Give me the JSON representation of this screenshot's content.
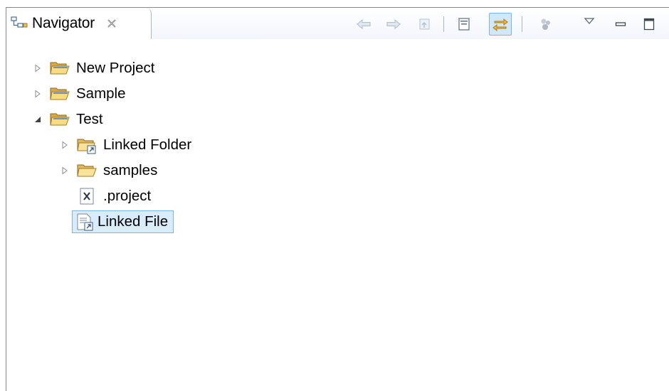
{
  "view": {
    "title": "Navigator",
    "icon": "navigator-icon",
    "close_icon": "close-icon"
  },
  "toolbar": {
    "back_icon": "back-arrow-icon",
    "forward_icon": "forward-arrow-icon",
    "up_icon": "up-folder-icon",
    "collapse_all_icon": "collapse-all-icon",
    "link_with_editor_icon": "link-with-editor-icon",
    "link_with_editor_pressed": true,
    "filters_icon": "filters-icon",
    "menu_icon": "view-menu-icon",
    "minimize_icon": "minimize-icon",
    "maximize_icon": "maximize-icon"
  },
  "tree": {
    "items": [
      {
        "label": "New Project",
        "icon": "project-folder-icon",
        "expanded": false,
        "depth": 0
      },
      {
        "label": "Sample",
        "icon": "project-folder-icon",
        "expanded": false,
        "depth": 0
      },
      {
        "label": "Test",
        "icon": "project-folder-icon",
        "expanded": true,
        "depth": 0
      },
      {
        "label": "Linked Folder",
        "icon": "linked-folder-icon",
        "expanded": false,
        "depth": 1
      },
      {
        "label": "samples",
        "icon": "folder-icon",
        "expanded": false,
        "depth": 1
      },
      {
        "label": ".project",
        "icon": "xml-file-icon",
        "depth": 1
      },
      {
        "label": "Linked File",
        "icon": "linked-file-icon",
        "depth": 1,
        "selected": true
      }
    ]
  },
  "colors": {
    "selection_bg": "#d9ecfb",
    "selection_border": "#7db4e8",
    "folder_yellow": "#f5d46b",
    "pressed_toggle_bg": "#cfe8fb"
  }
}
